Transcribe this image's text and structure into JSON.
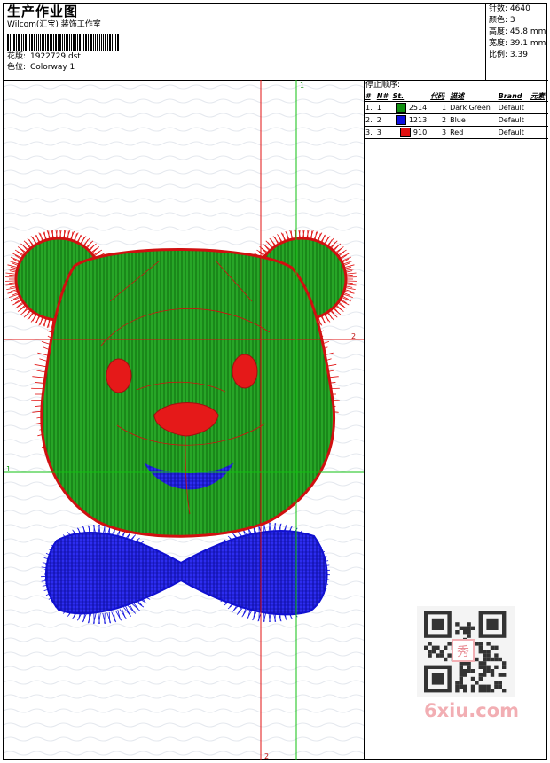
{
  "header": {
    "title": "生产作业图",
    "company": "Wilcom(汇宝) 装饰工作室",
    "design_label": "花版:",
    "design_file": "1922729.dst",
    "colorway_label": "色位:",
    "colorway": "Colorway 1"
  },
  "stats": [
    {
      "label": "针数:",
      "value": "4640"
    },
    {
      "label": "颜色:",
      "value": "3"
    },
    {
      "label": "高度:",
      "value": "45.8 mm"
    },
    {
      "label": "宽度:",
      "value": "39.1 mm"
    },
    {
      "label": "比例:",
      "value": "3.39"
    }
  ],
  "markers": {
    "v1": "1",
    "v2": "2",
    "h1": "1",
    "h2": "2"
  },
  "stop_sequence": {
    "title": "停止顺序:",
    "columns": [
      "#",
      "N#",
      "St.",
      "代码",
      "描述",
      "Brand",
      "元素"
    ],
    "rows": [
      {
        "num": "1.",
        "n": "1",
        "color": "#109010",
        "st": "2514",
        "code": "1",
        "desc": "Dark Green",
        "brand": "Default",
        "elem": ""
      },
      {
        "num": "2.",
        "n": "2",
        "color": "#1010e0",
        "st": "1213",
        "code": "2",
        "desc": "Blue",
        "brand": "Default",
        "elem": ""
      },
      {
        "num": "3.",
        "n": "3",
        "color": "#e01010",
        "st": "910",
        "code": "3",
        "desc": "Red",
        "brand": "Default",
        "elem": ""
      }
    ]
  },
  "watermark": {
    "text": "6xiu.com",
    "qr_badge": "秀",
    "color": "#f2aeb3"
  }
}
